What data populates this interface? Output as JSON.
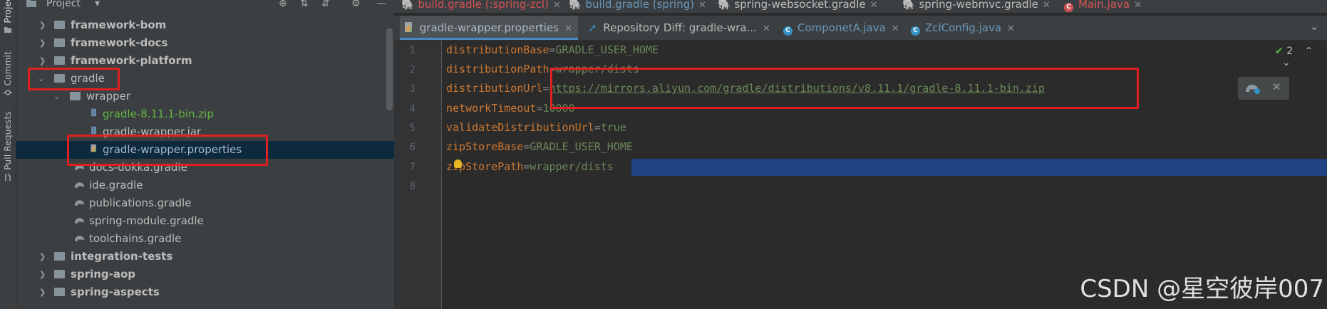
{
  "toolstrip": {
    "project_label": "Project",
    "commit_label": "Commit",
    "pull_requests_label": "Pull Requests"
  },
  "project_panel": {
    "title": "Project",
    "items": [
      {
        "label": "framework-bom"
      },
      {
        "label": "framework-docs"
      },
      {
        "label": "framework-platform"
      },
      {
        "label": "gradle"
      },
      {
        "label": "wrapper"
      },
      {
        "label": "gradle-8.11.1-bin.zip"
      },
      {
        "label": "gradle-wrapper.jar"
      },
      {
        "label": "gradle-wrapper.properties"
      },
      {
        "label": "docs-dokka.gradle"
      },
      {
        "label": "ide.gradle"
      },
      {
        "label": "publications.gradle"
      },
      {
        "label": "spring-module.gradle"
      },
      {
        "label": "toolchains.gradle"
      },
      {
        "label": "integration-tests"
      },
      {
        "label": "spring-aop"
      },
      {
        "label": "spring-aspects"
      }
    ]
  },
  "top_tabs": [
    {
      "label": "build.gradle (:spring-zcl)"
    },
    {
      "label": "build.gradle (spring)"
    },
    {
      "label": "spring-websocket.gradle"
    },
    {
      "label": "spring-webmvc.gradle"
    },
    {
      "label": "Main.java"
    }
  ],
  "editor_tabs": [
    {
      "label": "gradle-wrapper.properties"
    },
    {
      "label": "Repository Diff: gradle-wra..."
    },
    {
      "label": "ComponetA.java"
    },
    {
      "label": "ZclConfig.java"
    }
  ],
  "editor": {
    "line_numbers": [
      "1",
      "2",
      "3",
      "4",
      "5",
      "6",
      "7",
      "8"
    ],
    "lines": [
      {
        "key": "distributionBase",
        "value": "GRADLE_USER_HOME"
      },
      {
        "key": "distributionPath",
        "value": "wrapper/dists"
      },
      {
        "key": "distributionUrl",
        "value": "https://mirrors.aliyun.com/gradle/distributions/v8.11.1/gradle-8.11.1-bin.zip"
      },
      {
        "key": "networkTimeout",
        "value": "10000"
      },
      {
        "key": "validateDistributionUrl",
        "value": "true"
      },
      {
        "key": "zipStoreBase",
        "value": "GRADLE_USER_HOME"
      },
      {
        "key": "zipStorePath",
        "value": "wrapper/dists"
      }
    ],
    "inspection_count": "2"
  },
  "watermark": "CSDN @星空彼岸007",
  "colors": {
    "annotation_red": "#e02020",
    "selection_blue": "#214283",
    "key_orange": "#cc7832",
    "value_green": "#6a8759"
  }
}
